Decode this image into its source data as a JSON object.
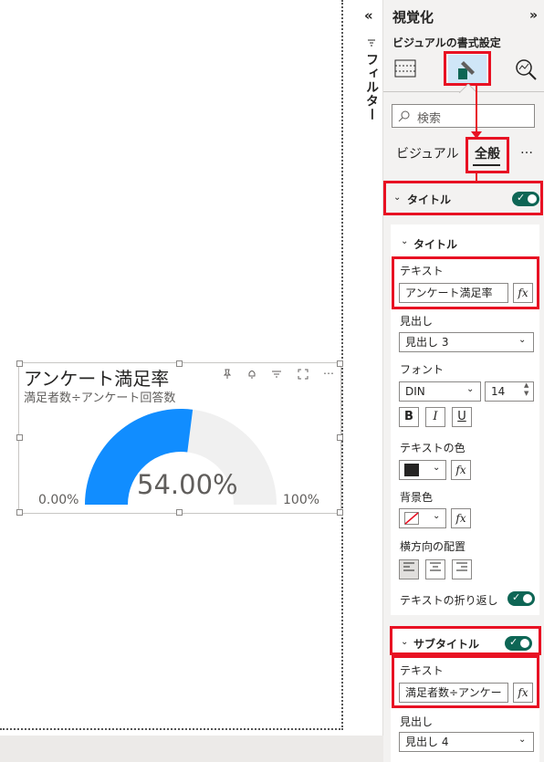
{
  "visual": {
    "title": "アンケート満足率",
    "subtitle": "満足者数÷アンケート回答数",
    "gauge_value": "54.00%",
    "gauge_fraction": 0.54,
    "min_label": "0.00%",
    "max_label": "100%",
    "gauge_fill_color": "#118dff",
    "gauge_track_color": "#f0f0f0"
  },
  "filter_pane": {
    "label": "フィルター",
    "collapse_glyph": "«"
  },
  "pane": {
    "title": "視覚化",
    "expand_glyph": "»",
    "subtitle": "ビジュアルの書式設定",
    "search_placeholder": "検索",
    "tabs": [
      "ビジュアル",
      "全般"
    ],
    "more": "…",
    "title_section": "タイトル",
    "title_card_heading": "タイトル",
    "text_label": "テキスト",
    "title_text": "アンケート満足率",
    "heading_label": "見出し",
    "heading_value": "見出し 3",
    "font_label": "フォント",
    "font_value": "DIN",
    "font_size": "14",
    "bold": "B",
    "italic": "I",
    "underline": "U",
    "text_color_label": "テキストの色",
    "bg_color_label": "背景色",
    "align_label": "横方向の配置",
    "wrap_label": "テキストの折り返し",
    "subtitle_section": "サブタイトル",
    "subtitle_text_label": "テキスト",
    "subtitle_text": "満足者数÷アンケー",
    "subtitle_heading_label": "見出し",
    "subtitle_heading_value": "見出し 4",
    "fx": "fx",
    "accent_color": "#e81123",
    "toggle_color": "#0e6655"
  }
}
